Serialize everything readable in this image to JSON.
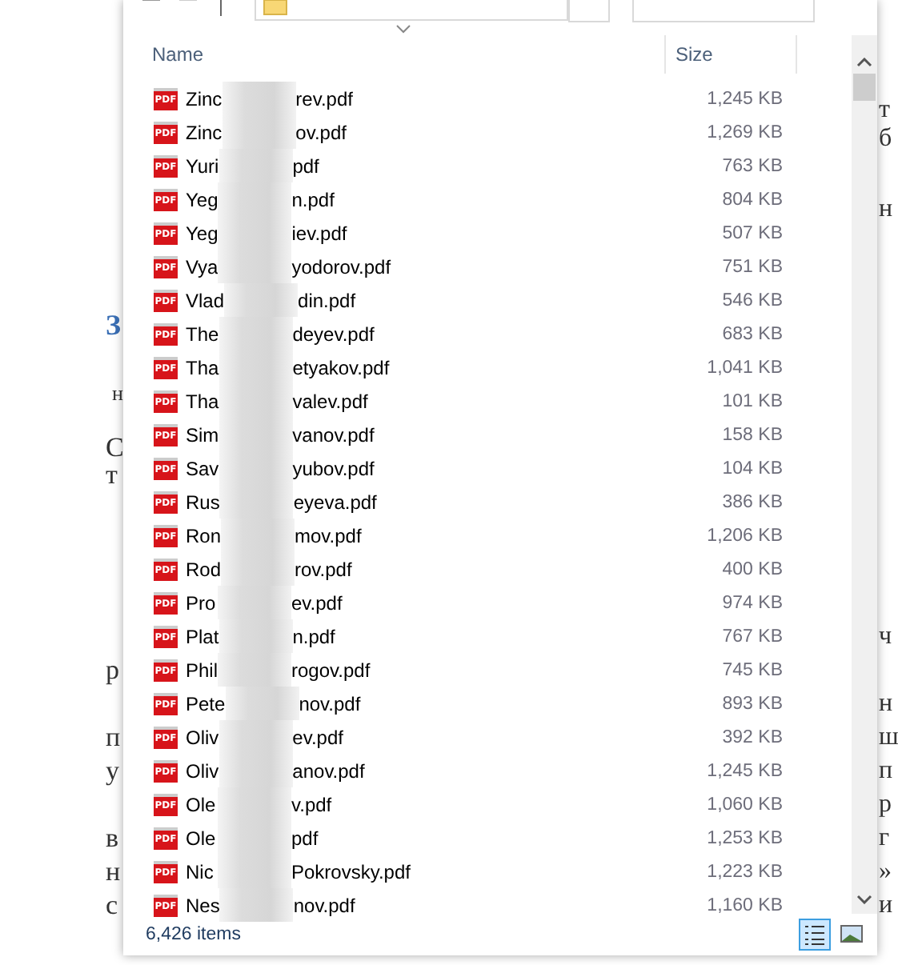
{
  "background_page": {
    "left_fragments": [
      {
        "text": "З",
        "kind": "heading"
      },
      {
        "text": "н",
        "kind": "small"
      },
      {
        "text": "С",
        "kind": "text"
      },
      {
        "text": "т",
        "kind": "text"
      },
      {
        "text": "р",
        "kind": "text"
      },
      {
        "text": "п",
        "kind": "text"
      },
      {
        "text": "у",
        "kind": "text"
      },
      {
        "text": "в",
        "kind": "text"
      },
      {
        "text": "н",
        "kind": "text"
      },
      {
        "text": "с",
        "kind": "text"
      }
    ],
    "right_fragments": [
      {
        "text": "т"
      },
      {
        "text": "б"
      },
      {
        "text": "н"
      },
      {
        "text": "ч"
      },
      {
        "text": "н"
      },
      {
        "text": "ш"
      },
      {
        "text": "п"
      },
      {
        "text": "р"
      },
      {
        "text": "г"
      },
      {
        "text": "»"
      },
      {
        "text": "и"
      }
    ]
  },
  "columns": [
    {
      "label": "Name"
    },
    {
      "label": "Size"
    }
  ],
  "files": [
    {
      "name_start": "Zinc",
      "name_end": "rev.pdf",
      "size": "1,245 KB",
      "icon_label": "PDF"
    },
    {
      "name_start": "Zinc",
      "name_end": "ov.pdf",
      "size": "1,269 KB",
      "icon_label": "PDF"
    },
    {
      "name_start": "Yuri",
      "name_end": "pdf",
      "size": "763 KB",
      "icon_label": "PDF"
    },
    {
      "name_start": "Yeg",
      "name_end": "n.pdf",
      "size": "804 KB",
      "icon_label": "PDF"
    },
    {
      "name_start": "Yeg",
      "name_end": "iev.pdf",
      "size": "507 KB",
      "icon_label": "PDF"
    },
    {
      "name_start": "Vya",
      "name_end": "yodorov.pdf",
      "size": "751 KB",
      "icon_label": "PDF"
    },
    {
      "name_start": "Vlad",
      "name_end": "din.pdf",
      "size": "546 KB",
      "icon_label": "PDF"
    },
    {
      "name_start": "The",
      "name_end": "deyev.pdf",
      "size": "683 KB",
      "icon_label": "PDF"
    },
    {
      "name_start": "Tha",
      "name_end": "etyakov.pdf",
      "size": "1,041 KB",
      "icon_label": "PDF"
    },
    {
      "name_start": "Tha",
      "name_end": "valev.pdf",
      "size": "101 KB",
      "icon_label": "PDF"
    },
    {
      "name_start": "Sim",
      "name_end": "vanov.pdf",
      "size": "158 KB",
      "icon_label": "PDF"
    },
    {
      "name_start": "Sav",
      "name_end": "yubov.pdf",
      "size": "104 KB",
      "icon_label": "PDF"
    },
    {
      "name_start": "Rus",
      "name_end": "eyeva.pdf",
      "size": "386 KB",
      "icon_label": "PDF"
    },
    {
      "name_start": "Ron",
      "name_end": "mov.pdf",
      "size": "1,206 KB",
      "icon_label": "PDF"
    },
    {
      "name_start": "Rod",
      "name_end": "rov.pdf",
      "size": "400 KB",
      "icon_label": "PDF"
    },
    {
      "name_start": "Pro",
      "name_end": "ev.pdf",
      "size": "974 KB",
      "icon_label": "PDF"
    },
    {
      "name_start": "Plat",
      "name_end": "n.pdf",
      "size": "767 KB",
      "icon_label": "PDF"
    },
    {
      "name_start": "Phil",
      "name_end": "rogov.pdf",
      "size": "745 KB",
      "icon_label": "PDF"
    },
    {
      "name_start": "Pete",
      "name_end": "nov.pdf",
      "size": "893 KB",
      "icon_label": "PDF"
    },
    {
      "name_start": "Oliv",
      "name_end": "ev.pdf",
      "size": "392 KB",
      "icon_label": "PDF"
    },
    {
      "name_start": "Oliv",
      "name_end": "anov.pdf",
      "size": "1,245 KB",
      "icon_label": "PDF"
    },
    {
      "name_start": "Ole",
      "name_end": "v.pdf",
      "size": "1,060 KB",
      "icon_label": "PDF"
    },
    {
      "name_start": "Ole",
      "name_end": "pdf",
      "size": "1,253 KB",
      "icon_label": "PDF"
    },
    {
      "name_start": "Nic",
      "name_end": "Pokrovsky.pdf",
      "size": "1,223 KB",
      "icon_label": "PDF"
    },
    {
      "name_start": "Nes",
      "name_end": "nov.pdf",
      "size": "1,160 KB",
      "icon_label": "PDF"
    }
  ],
  "status_bar": {
    "item_count": "6,426 items",
    "views": [
      {
        "kind": "details",
        "selected": true
      },
      {
        "kind": "thumbnails",
        "selected": false
      }
    ]
  }
}
